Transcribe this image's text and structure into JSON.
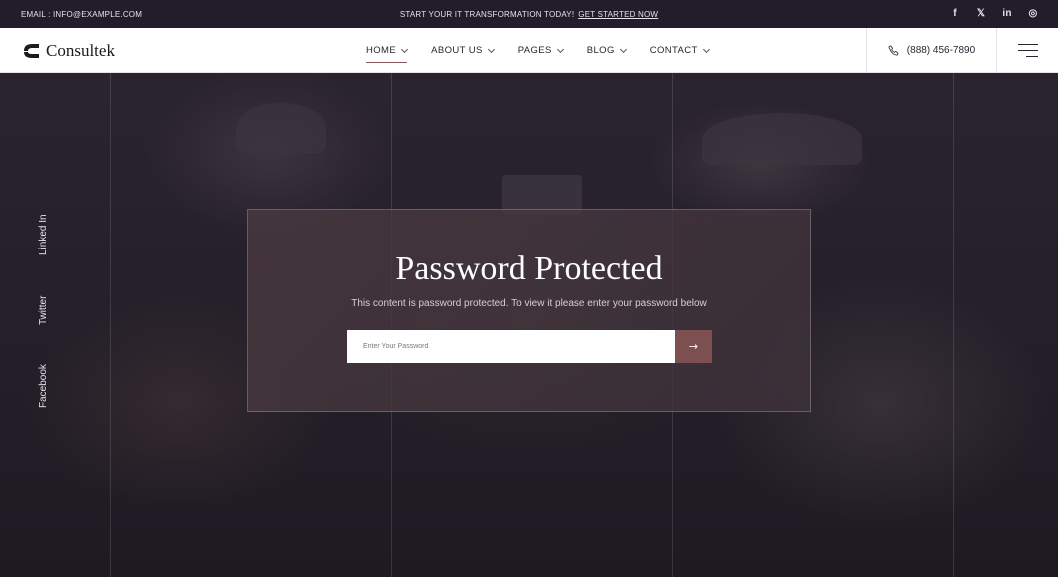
{
  "topbar": {
    "email": "EMAIL : INFO@EXAMPLE.COM",
    "promo_text": "START YOUR IT TRANSFORMATION TODAY!",
    "promo_link": "GET STARTED NOW",
    "social": [
      {
        "icon": "facebook-icon",
        "glyph": "f"
      },
      {
        "icon": "x-icon",
        "glyph": "𝕏"
      },
      {
        "icon": "linkedin-icon",
        "glyph": "in"
      },
      {
        "icon": "instagram-icon",
        "glyph": "◎"
      }
    ]
  },
  "header": {
    "brand": "Consultek",
    "nav": [
      {
        "label": "HOME"
      },
      {
        "label": "ABOUT US"
      },
      {
        "label": "PAGES"
      },
      {
        "label": "BLOG"
      },
      {
        "label": "CONTACT"
      }
    ],
    "phone": "(888) 456-7890",
    "phone_icon": "phone-icon",
    "menu_icon": "hamburger-menu-icon"
  },
  "side_social": [
    "Linked In",
    "Twitter",
    "Facebook"
  ],
  "protected": {
    "title": "Password Protected",
    "message": "This content is password protected. To view it please enter your password below",
    "placeholder": "Enter Your Password",
    "submit_glyph": "→",
    "submit_icon": "arrow-right-icon"
  },
  "colors": {
    "accent": "#7e4f51",
    "topbar_bg": "#221d2a",
    "hero_bg": "#241f29"
  }
}
